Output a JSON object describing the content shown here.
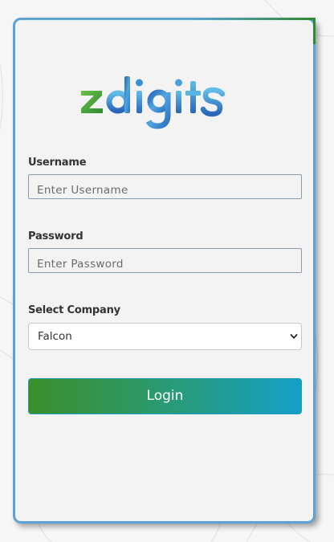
{
  "brand": {
    "logo_text": "zdigits",
    "colors": {
      "green": "#3aa13a",
      "blue_light": "#5ab4e4",
      "blue_dark": "#2060b0"
    }
  },
  "form": {
    "username": {
      "label": "Username",
      "placeholder": "Enter Username",
      "value": ""
    },
    "password": {
      "label": "Password",
      "placeholder": "Enter Password",
      "value": ""
    },
    "company": {
      "label": "Select Company",
      "selected": "Falcon"
    },
    "login_label": "Login"
  },
  "theme": {
    "card_border": "#5ba3d6",
    "button_gradient_start": "#3a8f2a",
    "button_gradient_end": "#15a0c8"
  }
}
